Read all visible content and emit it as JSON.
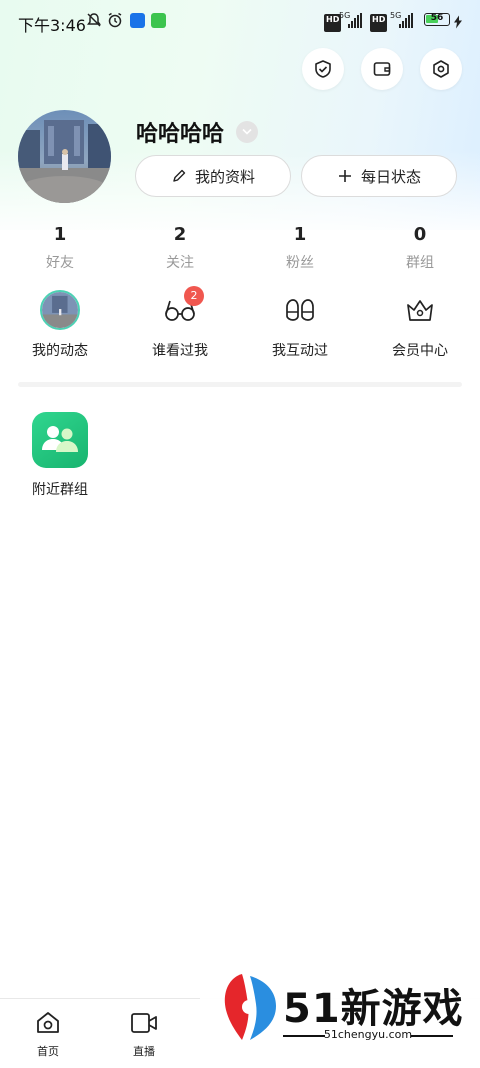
{
  "status_bar": {
    "time": "下午3:46",
    "network_1": "5G",
    "network_2": "5G",
    "hd_1": "HD",
    "hd_2": "HD",
    "battery": "56",
    "battery_level": 0.56,
    "icons": [
      "bell-mute-icon",
      "alarm-icon",
      "app-notification-icon",
      "app-notification-icon",
      "signal-icon",
      "battery-icon",
      "charging-icon"
    ]
  },
  "top_actions": [
    {
      "icon": "shield-check-icon"
    },
    {
      "icon": "wallet-icon"
    },
    {
      "icon": "settings-hexagon-icon"
    }
  ],
  "profile": {
    "username": "哈哈哈哈",
    "edit_profile_label": "我的资料",
    "daily_status_label": "每日状态"
  },
  "stats": [
    {
      "value": "1",
      "label": "好友"
    },
    {
      "value": "2",
      "label": "关注"
    },
    {
      "value": "1",
      "label": "粉丝"
    },
    {
      "value": "0",
      "label": "群组"
    }
  ],
  "shortcuts": [
    {
      "label": "我的动态",
      "icon": "avatar-thumbnail"
    },
    {
      "label": "谁看过我",
      "icon": "glasses-icon",
      "badge": "2"
    },
    {
      "label": "我互动过",
      "icon": "footprints-icon"
    },
    {
      "label": "会员中心",
      "icon": "crown-icon"
    }
  ],
  "apps": [
    {
      "label": "附近群组",
      "icon": "nearby-group-icon"
    }
  ],
  "bottom_nav": [
    {
      "label": "首页",
      "icon": "home-icon"
    },
    {
      "label": "直播",
      "icon": "video-camera-icon"
    }
  ],
  "watermark": {
    "text": "51新游戏",
    "url": "51chengyu.com"
  },
  "colors": {
    "accent_green": "#1fc07a",
    "badge_red": "#f0574f",
    "watermark_red": "#e5262b",
    "watermark_blue": "#2a8ee0"
  }
}
